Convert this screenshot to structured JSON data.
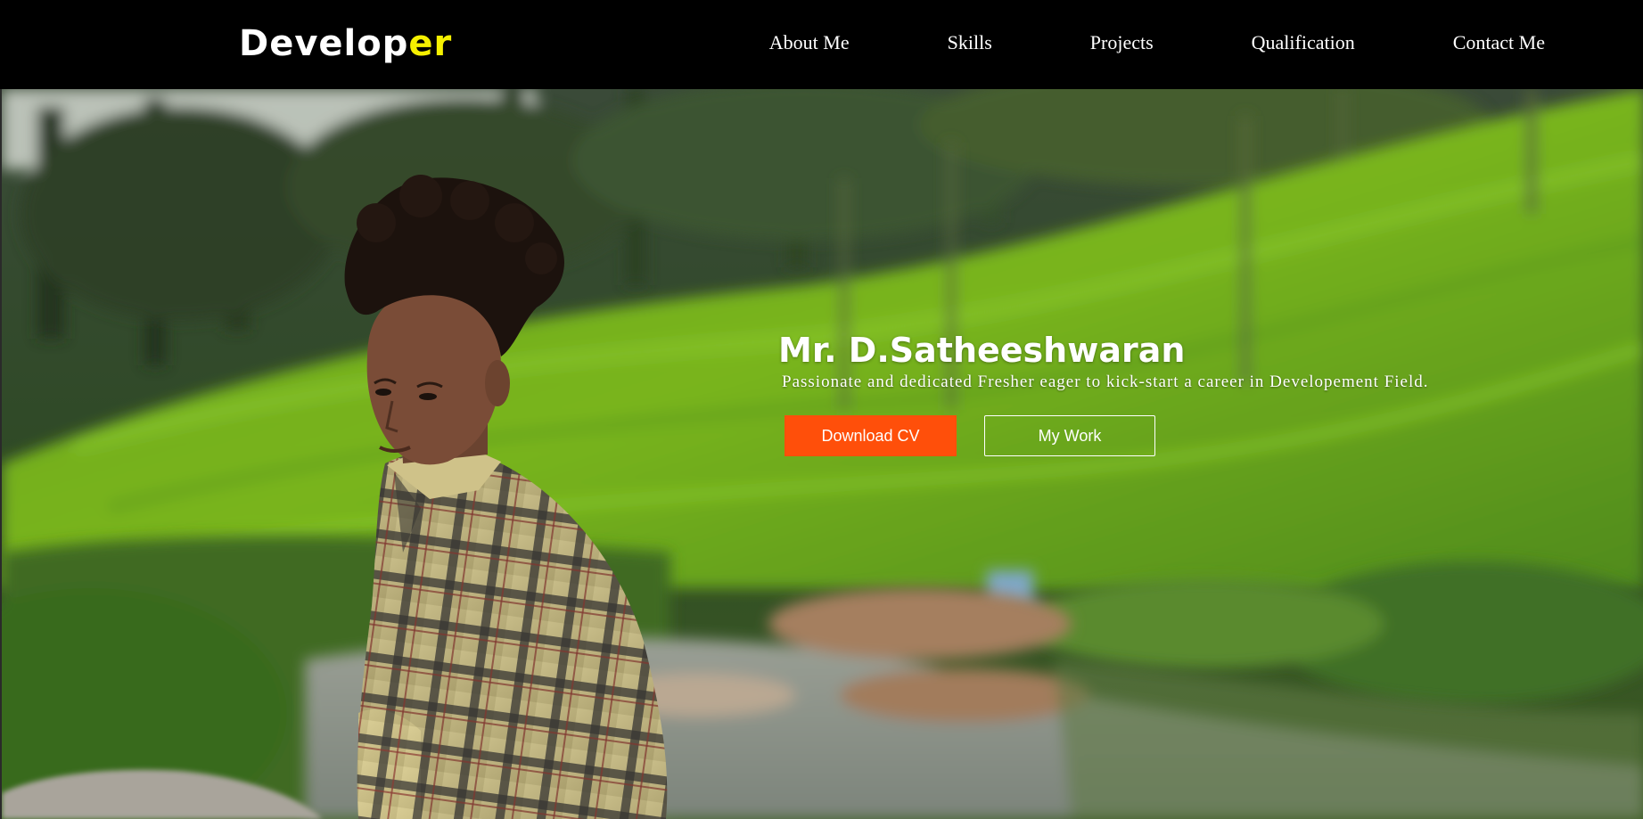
{
  "brand": {
    "main": "Develop",
    "accent": "er",
    "accent_color": "#f5f000"
  },
  "nav": {
    "items": [
      {
        "label": "About Me"
      },
      {
        "label": "Skills"
      },
      {
        "label": "Projects"
      },
      {
        "label": "Qualification"
      },
      {
        "label": "Contact Me"
      }
    ]
  },
  "hero": {
    "name": "Mr. D.Satheeshwaran",
    "tagline": "Passionate and dedicated Fresher eager to kick-start a career in Developement Field.",
    "primary_button": "Download CV",
    "secondary_button": "My Work",
    "primary_color": "#ff4f0a",
    "background_photo": "person in plaid shirt in front of tea plantation hills and stream"
  }
}
